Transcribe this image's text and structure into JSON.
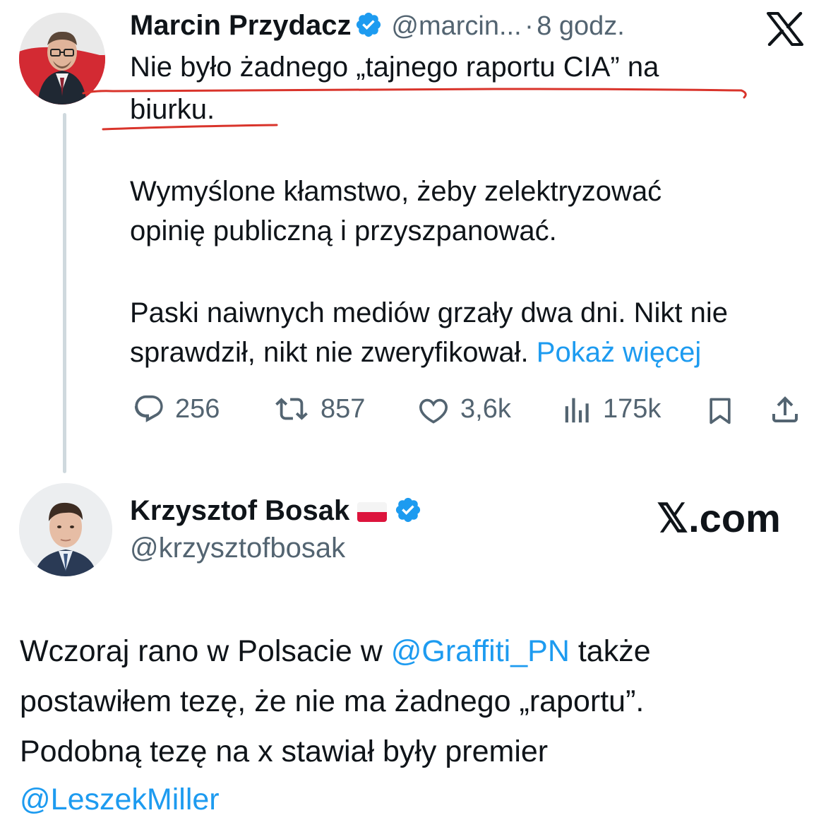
{
  "tweet1": {
    "author_name": "Marcin Przydacz",
    "handle": "@marcin...",
    "separator": "·",
    "time": "8 godz.",
    "line1": "Nie było żadnego „tajnego raportu CIA” na",
    "line2": "biurku.",
    "paragraph2_line1": "Wymyślone kłamstwo, żeby zelektryzować",
    "paragraph2_line2": "opinię publiczną i przyszpanować.",
    "paragraph3_line1": "Paski naiwnych mediów grzały dwa dni. Nikt nie",
    "paragraph3_line2": "sprawdził, nikt nie zweryfikował.",
    "show_more": "Pokaż więcej",
    "actions": {
      "replies": "256",
      "reposts": "857",
      "likes": "3,6k",
      "views": "175k"
    },
    "platform_logo": "X",
    "icons": {
      "verified": "verified-badge-icon",
      "reply": "reply-icon",
      "repost": "repost-icon",
      "like": "heart-icon",
      "views": "views-icon",
      "bookmark": "bookmark-icon",
      "share": "share-icon"
    }
  },
  "tweet2": {
    "author_name": "Krzysztof Bosak",
    "flag": "🇵🇱",
    "handle": "@krzysztofbosak",
    "watermark": "𝕏.com",
    "text_line1_a": "Wczoraj rano w Polsacie w",
    "text_line1_mention": "@Graffiti_PN",
    "text_line1_b": "także",
    "text_line2": "postawiłem tezę, że nie ma żadnego „raportu”.",
    "text_line3": "Podobną tezę na x stawiał były premier",
    "text_line4_mention": "@LeszekMiller"
  },
  "colors": {
    "text": "#0f1419",
    "muted": "#536471",
    "link": "#1d9bf0",
    "verified": "#1d9bf0",
    "underline_annotation": "#d9342b",
    "thread_line": "#cfd9de"
  }
}
